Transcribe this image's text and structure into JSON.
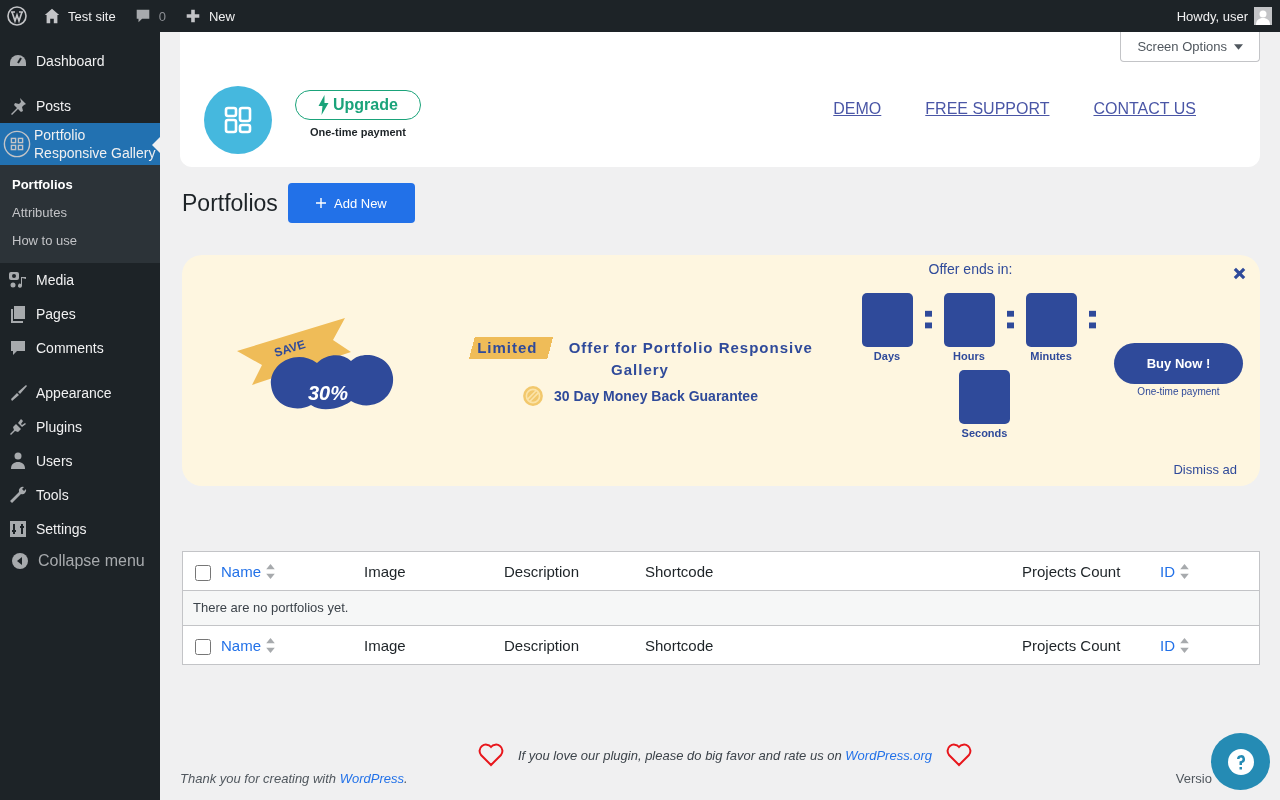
{
  "admin_bar": {
    "site": "Test site",
    "comments": "0",
    "new": "New",
    "greeting": "Howdy, user"
  },
  "sidebar": {
    "groups": [
      [
        {
          "label": "Dashboard",
          "selected": false
        }
      ],
      [
        {
          "label": "Posts",
          "selected": false
        },
        {
          "label": "Portfolio Responsive Gallery",
          "selected": true,
          "submenu": [
            {
              "label": "Portfolios",
              "selected": true
            },
            {
              "label": "Attributes",
              "selected": false
            },
            {
              "label": "How to use",
              "selected": false
            }
          ]
        },
        {
          "label": "Media",
          "selected": false
        },
        {
          "label": "Pages",
          "selected": false
        },
        {
          "label": "Comments",
          "selected": false
        }
      ],
      [
        {
          "label": "Appearance",
          "selected": false
        },
        {
          "label": "Plugins",
          "selected": false
        },
        {
          "label": "Users",
          "selected": false
        },
        {
          "label": "Tools",
          "selected": false
        },
        {
          "label": "Settings",
          "selected": false
        }
      ]
    ],
    "collapse": "Collapse menu"
  },
  "header": {
    "screen_options": "Screen Options",
    "upgrade": "Upgrade",
    "upgrade_note": "One-time payment",
    "links": [
      "DEMO",
      "FREE SUPPORT",
      "CONTACT US"
    ]
  },
  "page": {
    "title": "Portfolios",
    "add_new": "Add New"
  },
  "banner": {
    "save": "SAVE",
    "discount": "30%",
    "tag": "Limited",
    "offer": "Offer for Portfolio Responsive Gallery",
    "guarantee": "30 Day Money Back Guarantee",
    "ends_label": "Offer ends in:",
    "units": [
      {
        "label": "Days"
      },
      {
        "label": "Hours"
      },
      {
        "label": "Minutes"
      },
      {
        "label": "Seconds"
      }
    ],
    "buy": "Buy Now !",
    "buy_note": "One-time payment",
    "dismiss": "Dismiss ad"
  },
  "table": {
    "header_checked": false,
    "footer_checked": false,
    "header_columns": [
      {
        "label": "Name",
        "sortable": true
      },
      {
        "label": "Image",
        "sortable": false
      },
      {
        "label": "Description",
        "sortable": false
      },
      {
        "label": "Shortcode",
        "sortable": false
      },
      {
        "label": "Projects Count",
        "sortable": false
      },
      {
        "label": "ID",
        "sortable": true
      }
    ],
    "empty_message": "There are no portfolios yet.",
    "footer_columns": [
      {
        "label": "Name",
        "sortable": true
      },
      {
        "label": "Image",
        "sortable": false
      },
      {
        "label": "Description",
        "sortable": false
      },
      {
        "label": "Shortcode",
        "sortable": false
      },
      {
        "label": "Projects Count",
        "sortable": false
      },
      {
        "label": "ID",
        "sortable": true
      }
    ]
  },
  "footer": {
    "rate_text": "If you love our plugin, please do big favor and rate us on",
    "rate_link": "WordPress.org",
    "thanks_text": "Thank you for creating with",
    "thanks_link": "WordPress",
    "thanks_end": ".",
    "version": "Versio"
  }
}
